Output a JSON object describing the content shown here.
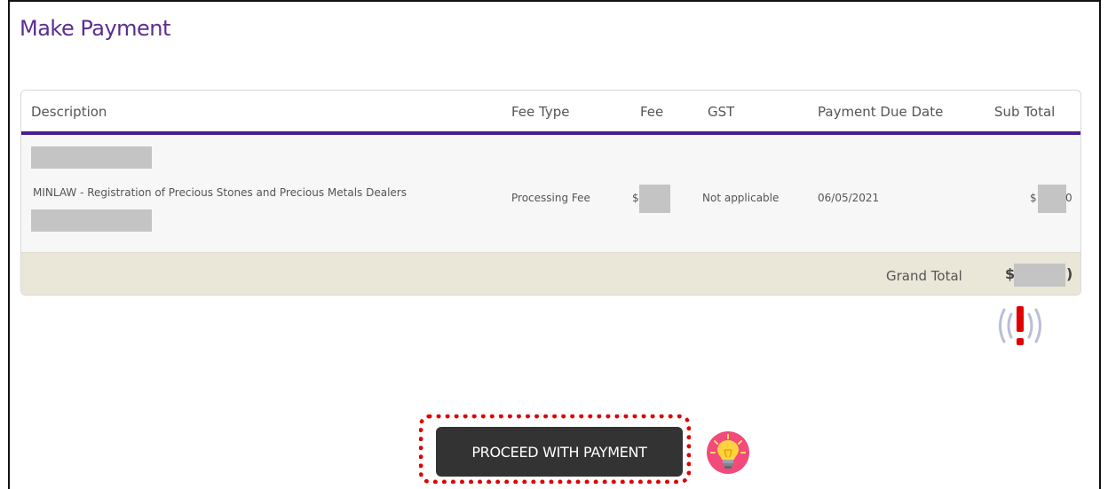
{
  "page": {
    "title": "Make Payment"
  },
  "table": {
    "headers": {
      "description": "Description",
      "fee_type": "Fee Type",
      "fee": "Fee",
      "gst": "GST",
      "due_date": "Payment Due Date",
      "sub_total": "Sub Total"
    },
    "row": {
      "description": "MINLAW - Registration of Precious Stones and Precious Metals Dealers",
      "fee_type": "Processing Fee",
      "fee_prefix": "$",
      "gst": "Not applicable",
      "due_date": "06/05/2021",
      "sub_total_prefix": "$1",
      "sub_total_suffix": "0"
    },
    "total": {
      "label": "Grand Total",
      "value_prefix": "$",
      "value_suffix": ")"
    }
  },
  "actions": {
    "proceed_label": "PROCEED WITH PAYMENT"
  },
  "icons": {
    "alert": "alert-exclamation-icon",
    "tip": "lightbulb-icon"
  },
  "colors": {
    "accent": "#5c2d91",
    "highlight": "#e00000",
    "button": "#333333"
  }
}
